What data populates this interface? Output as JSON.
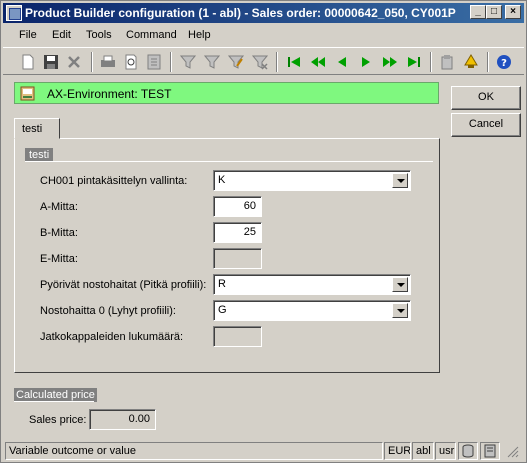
{
  "window": {
    "title": "Product Builder configuration (1 - abl) - Sales order: 00000642_050, CY001P",
    "controls": [
      "_",
      "□",
      "×"
    ]
  },
  "menu": [
    "File",
    "Edit",
    "Tools",
    "Command",
    "Help"
  ],
  "toolbar_icons": [
    "new-icon",
    "save-icon",
    "delete-icon",
    "print-icon",
    "print-preview-icon",
    "export-icon",
    "filter-icon",
    "filter-by-field-icon",
    "filter-by-selection-icon",
    "remove-filter-icon",
    "first-record-icon",
    "previous-page-icon",
    "previous-record-icon",
    "next-record-icon",
    "next-page-icon",
    "last-record-icon",
    "attach-icon",
    "alert-icon",
    "help-icon"
  ],
  "environment": {
    "text": "AX-Environment: TEST",
    "color": "#7ff87f"
  },
  "buttons": {
    "ok": "OK",
    "cancel": "Cancel"
  },
  "tab": {
    "label": "testi"
  },
  "group": {
    "label": "testi"
  },
  "fields": [
    {
      "label": "CH001 pintakäsittelyn vallinta:",
      "value": "K",
      "type": "combo"
    },
    {
      "label": "A-Mitta:",
      "value": "60",
      "type": "number"
    },
    {
      "label": "B-Mitta:",
      "value": "25",
      "type": "number"
    },
    {
      "label": "E-Mitta:",
      "value": "",
      "type": "disabled"
    },
    {
      "label": "Pyörivät nostohaitat (Pitkä profiili):",
      "value": "R",
      "type": "combo"
    },
    {
      "label": "Nostohaitta 0  (Lyhyt profiili):",
      "value": "G",
      "type": "combo"
    },
    {
      "label": "Jatkokappaleiden lukumäärä:",
      "value": "",
      "type": "disabled"
    }
  ],
  "calculated_price": {
    "label": "Calculated price",
    "sales_price_label": "Sales price:",
    "sales_price_value": "0.00"
  },
  "statusbar": {
    "message": "Variable outcome or value",
    "currency": "EUR",
    "company": "abl",
    "user": "usr"
  }
}
